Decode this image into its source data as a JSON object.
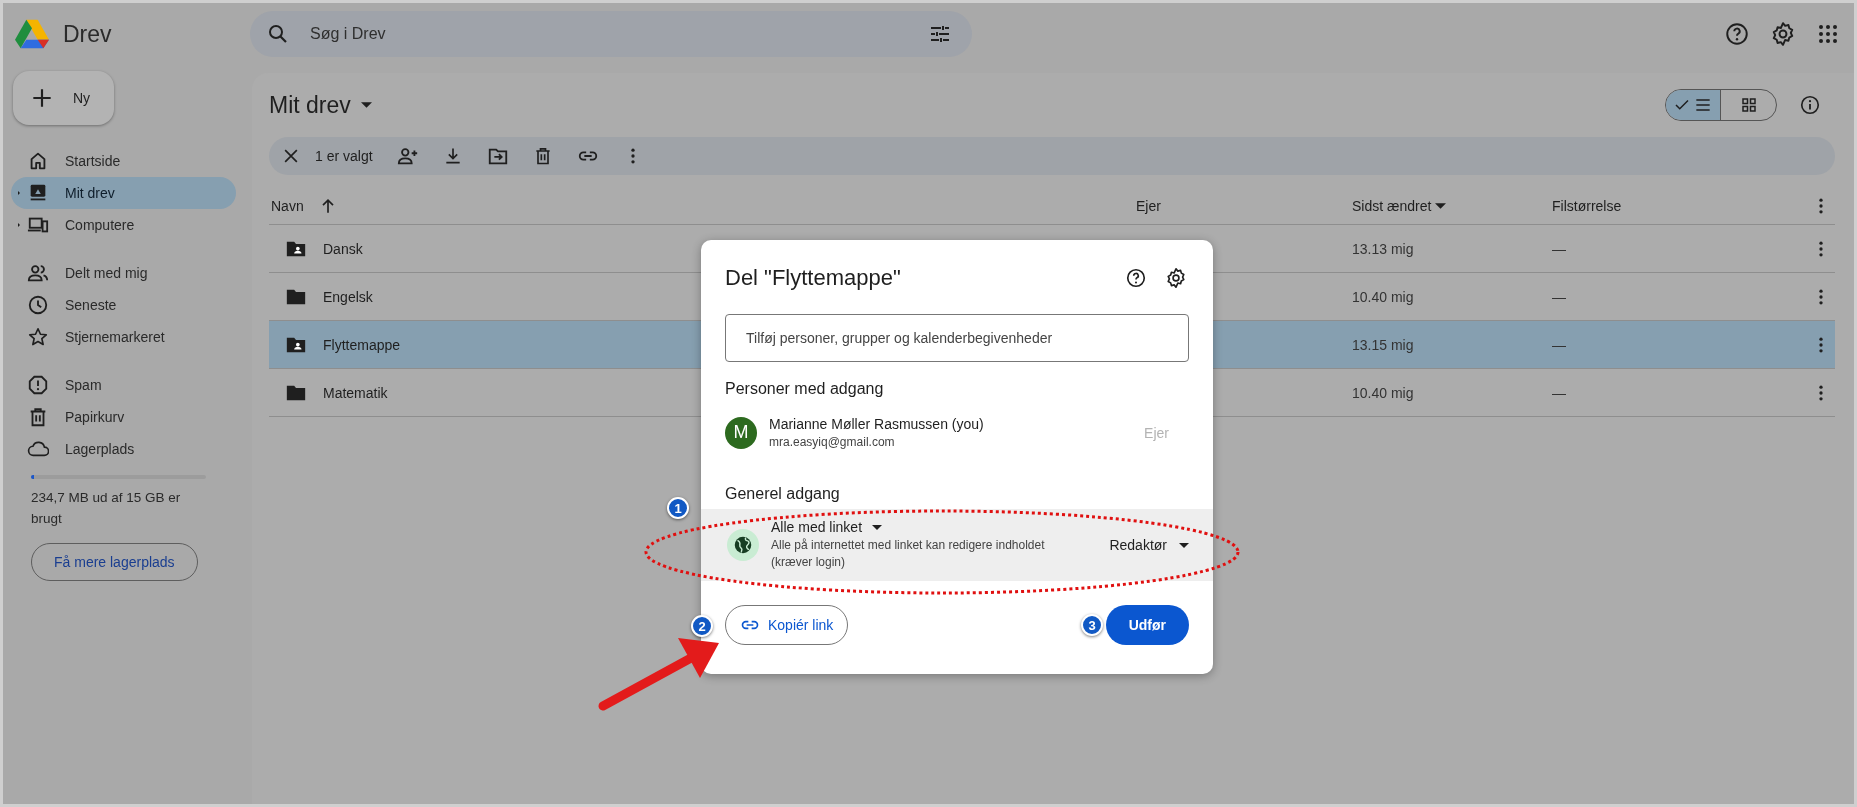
{
  "app": {
    "name": "Drev"
  },
  "search": {
    "placeholder": "Søg i Drev"
  },
  "new_button": {
    "label": "Ny"
  },
  "sidebar": {
    "groups": [
      {
        "items": [
          {
            "label": "Startside",
            "kind": "plain",
            "selected": false
          },
          {
            "label": "Mit drev",
            "kind": "tree",
            "expanded": false,
            "selected": true
          },
          {
            "label": "Computere",
            "kind": "tree",
            "expanded": false,
            "selected": false
          }
        ]
      },
      {
        "items": [
          {
            "label": "Delt med mig",
            "kind": "plain",
            "selected": false
          },
          {
            "label": "Seneste",
            "kind": "plain",
            "selected": false
          },
          {
            "label": "Stjernemarkeret",
            "kind": "plain",
            "selected": false
          }
        ]
      },
      {
        "items": [
          {
            "label": "Spam",
            "kind": "plain",
            "selected": false
          },
          {
            "label": "Papirkurv",
            "kind": "plain",
            "selected": false
          },
          {
            "label": "Lagerplads",
            "kind": "plain",
            "selected": false
          }
        ]
      }
    ]
  },
  "storage": {
    "level": 0.016,
    "usage": "234,7 MB ud af 15 GB er brugt",
    "button": "Få mere lagerplads"
  },
  "page_title": "Mit drev",
  "view_toggle": [
    {
      "kind": "list",
      "selected": true
    },
    {
      "kind": "grid",
      "selected": false
    }
  ],
  "selection_bar": {
    "count": "1 er valgt"
  },
  "table": {
    "columns": [
      {
        "label": "Navn",
        "kind": "sort-arrow"
      },
      {
        "label": "Ejer",
        "kind": "plain"
      },
      {
        "label": "Sidst ændret",
        "kind": "sort-caret"
      },
      {
        "label": "Filstørrelse",
        "kind": "plain"
      }
    ],
    "rows": [
      {
        "name": "Dansk",
        "kind": "shared-folder",
        "modified": "13.13 mig",
        "size": "—",
        "selected": false
      },
      {
        "name": "Engelsk",
        "kind": "folder",
        "modified": "10.40 mig",
        "size": "—",
        "selected": false
      },
      {
        "name": "Flyttemappe",
        "kind": "shared-folder",
        "modified": "13.15 mig",
        "size": "—",
        "selected": true
      },
      {
        "name": "Matematik",
        "kind": "folder",
        "modified": "10.40 mig",
        "size": "—",
        "selected": false
      }
    ]
  },
  "share_dialog": {
    "title": "Del \"Flyttemappe\"",
    "placeholder": "Tilføj personer, grupper og kalenderbegivenheder",
    "people_heading": "Personer med adgang",
    "people": [
      {
        "initial": "M",
        "name": "Marianne Møller Rasmussen (you)",
        "email": "mra.easyiq@gmail.com",
        "role": "Ejer",
        "color": "#2d6a1f"
      }
    ],
    "general_heading": "Generel adgang",
    "access": {
      "scope": "Alle med linket",
      "description": "Alle på internettet med linket kan redigere indholdet (kræver login)",
      "role": "Redaktør"
    },
    "copy_link": "Kopiér link",
    "done": "Udfør"
  },
  "annotations": {
    "badges": [
      "1",
      "2",
      "3"
    ]
  }
}
